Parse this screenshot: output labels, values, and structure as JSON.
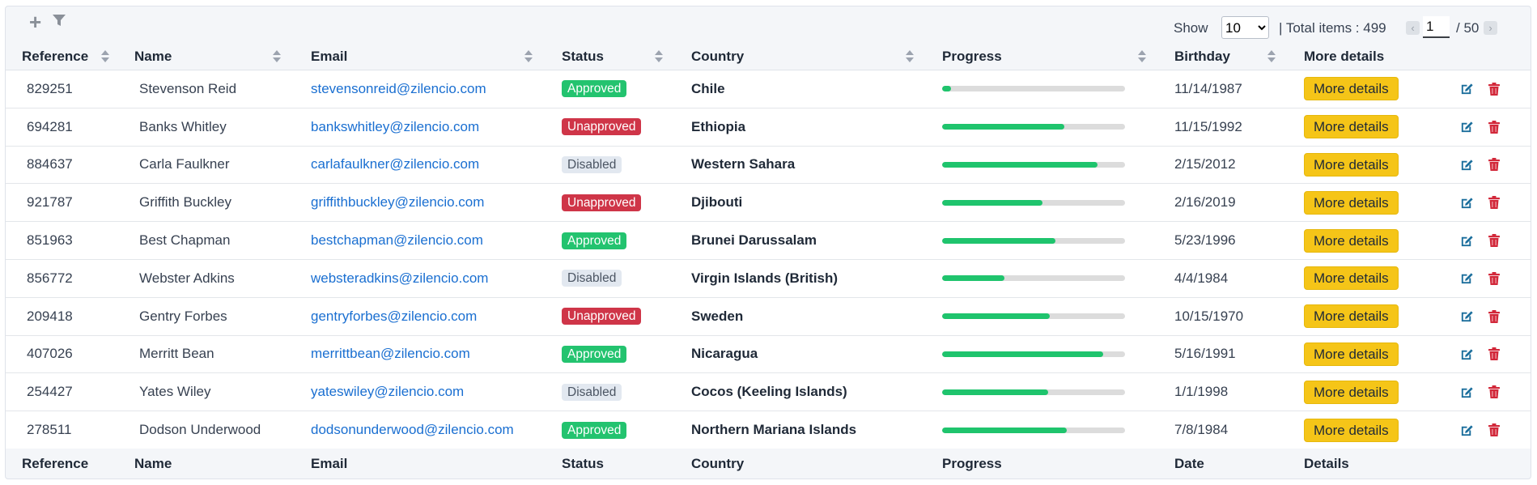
{
  "toolbar": {
    "add_icon": "plus-icon",
    "filter_icon": "filter-icon"
  },
  "pager": {
    "show_label": "Show",
    "page_size": "10",
    "page_size_options": [
      "10"
    ],
    "total_text": "| Total items : 499",
    "current_page": "1",
    "of_text": "/ 50",
    "prev_symbol": "‹",
    "next_symbol": "›"
  },
  "header": {
    "reference": "Reference",
    "name": "Name",
    "email": "Email",
    "status": "Status",
    "country": "Country",
    "progress": "Progress",
    "birthday": "Birthday",
    "more_details": "More details"
  },
  "footer": {
    "reference": "Reference",
    "name": "Name",
    "email": "Email",
    "status": "Status",
    "country": "Country",
    "progress": "Progress",
    "date": "Date",
    "details": "Details"
  },
  "colors": {
    "approved": "#23c36f",
    "unapproved": "#cf3548",
    "disabled": "#e2e8f0",
    "progress_fill": "#1fc46d",
    "more_button": "#f5c518",
    "link": "#1a6fd1",
    "edit_icon": "#1b6e9c",
    "delete_icon": "#d2283a"
  },
  "more_label": "More details",
  "rows": [
    {
      "ref": "829251",
      "name": "Stevenson Reid",
      "email": "stevensonreid@zilencio.com",
      "status": "Approved",
      "country": "Chile",
      "progress": 0.05,
      "birthday": "11/14/1987"
    },
    {
      "ref": "694281",
      "name": "Banks Whitley",
      "email": "bankswhitley@zilencio.com",
      "status": "Unapproved",
      "country": "Ethiopia",
      "progress": 0.67,
      "birthday": "11/15/1992"
    },
    {
      "ref": "884637",
      "name": "Carla Faulkner",
      "email": "carlafaulkner@zilencio.com",
      "status": "Disabled",
      "country": "Western Sahara",
      "progress": 0.85,
      "birthday": "2/15/2012"
    },
    {
      "ref": "921787",
      "name": "Griffith Buckley",
      "email": "griffithbuckley@zilencio.com",
      "status": "Unapproved",
      "country": "Djibouti",
      "progress": 0.55,
      "birthday": "2/16/2019"
    },
    {
      "ref": "851963",
      "name": "Best Chapman",
      "email": "bestchapman@zilencio.com",
      "status": "Approved",
      "country": "Brunei Darussalam",
      "progress": 0.62,
      "birthday": "5/23/1996"
    },
    {
      "ref": "856772",
      "name": "Webster Adkins",
      "email": "websteradkins@zilencio.com",
      "status": "Disabled",
      "country": "Virgin Islands (British)",
      "progress": 0.34,
      "birthday": "4/4/1984"
    },
    {
      "ref": "209418",
      "name": "Gentry Forbes",
      "email": "gentryforbes@zilencio.com",
      "status": "Unapproved",
      "country": "Sweden",
      "progress": 0.59,
      "birthday": "10/15/1970"
    },
    {
      "ref": "407026",
      "name": "Merritt Bean",
      "email": "merrittbean@zilencio.com",
      "status": "Approved",
      "country": "Nicaragua",
      "progress": 0.88,
      "birthday": "5/16/1991"
    },
    {
      "ref": "254427",
      "name": "Yates Wiley",
      "email": "yateswiley@zilencio.com",
      "status": "Disabled",
      "country": "Cocos (Keeling Islands)",
      "progress": 0.58,
      "birthday": "1/1/1998"
    },
    {
      "ref": "278511",
      "name": "Dodson Underwood",
      "email": "dodsonunderwood@zilencio.com",
      "status": "Approved",
      "country": "Northern Mariana Islands",
      "progress": 0.68,
      "birthday": "7/8/1984"
    }
  ]
}
